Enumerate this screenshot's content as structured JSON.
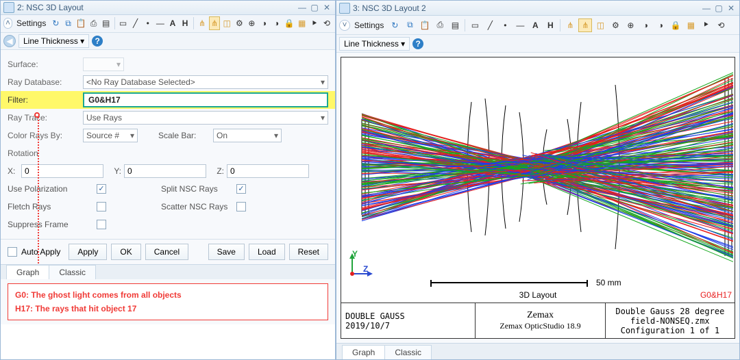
{
  "left": {
    "window_title": "2: NSC 3D Layout",
    "settings_label": "Settings",
    "line_thickness_label": "Line Thickness",
    "fields": {
      "surface_label": "Surface:",
      "raydb_label": "Ray Database:",
      "raydb_value": "<No Ray Database Selected>",
      "filter_label": "Filter:",
      "filter_value": "G0&H17",
      "raytrace_label": "Ray Trace:",
      "raytrace_value": "Use Rays",
      "color_label": "Color Rays By:",
      "color_value": "Source #",
      "scalebar_label": "Scale Bar:",
      "scalebar_value": "On",
      "rotation_label": "Rotation",
      "x_label": "X:",
      "x_value": "0",
      "y_label": "Y:",
      "y_value": "0",
      "z_label": "Z:",
      "z_value": "0",
      "use_pol_label": "Use Polarization",
      "use_pol_checked": "✓",
      "split_label": "Split NSC Rays",
      "split_checked": "✓",
      "fletch_label": "Fletch Rays",
      "scatter_label": "Scatter NSC Rays",
      "suppress_label": "Suppress Frame",
      "auto_apply_label": "Auto Apply"
    },
    "buttons": {
      "apply": "Apply",
      "ok": "OK",
      "cancel": "Cancel",
      "save": "Save",
      "load": "Load",
      "reset": "Reset"
    },
    "tabs": {
      "graph": "Graph",
      "classic": "Classic"
    },
    "callout_line1": "G0: The ghost light comes from all objects",
    "callout_line2": "H17: The rays that hit object 17"
  },
  "right": {
    "window_title": "3: NSC 3D Layout 2",
    "settings_label": "Settings",
    "line_thickness_label": "Line Thickness",
    "axes": {
      "y": "Y",
      "z": "Z"
    },
    "scale_label": "50 mm",
    "title_3d": "3D Layout",
    "filter_tag": "G0&H17",
    "info": {
      "project": "DOUBLE GAUSS",
      "date": "2019/10/7",
      "brand": "Zemax",
      "product": "Zemax OpticStudio 18.9",
      "file": "Double Gauss 28 degree field-NONSEQ.zmx",
      "config": "Configuration 1 of 1"
    },
    "tabs": {
      "graph": "Graph",
      "classic": "Classic"
    }
  },
  "icons": {
    "refresh": "↻",
    "copy": "⧉",
    "print": "⎙",
    "rect": "▭",
    "line": "╱",
    "dot": "•",
    "dash": "—",
    "A": "A",
    "H": "H",
    "scissors": "✂",
    "trident": "⋔",
    "cube": "◫",
    "gear": "⚙",
    "target": "⊕",
    "compass": "◑",
    "rot1": "⟳",
    "rot2": "⟲",
    "zoom": "Z"
  }
}
